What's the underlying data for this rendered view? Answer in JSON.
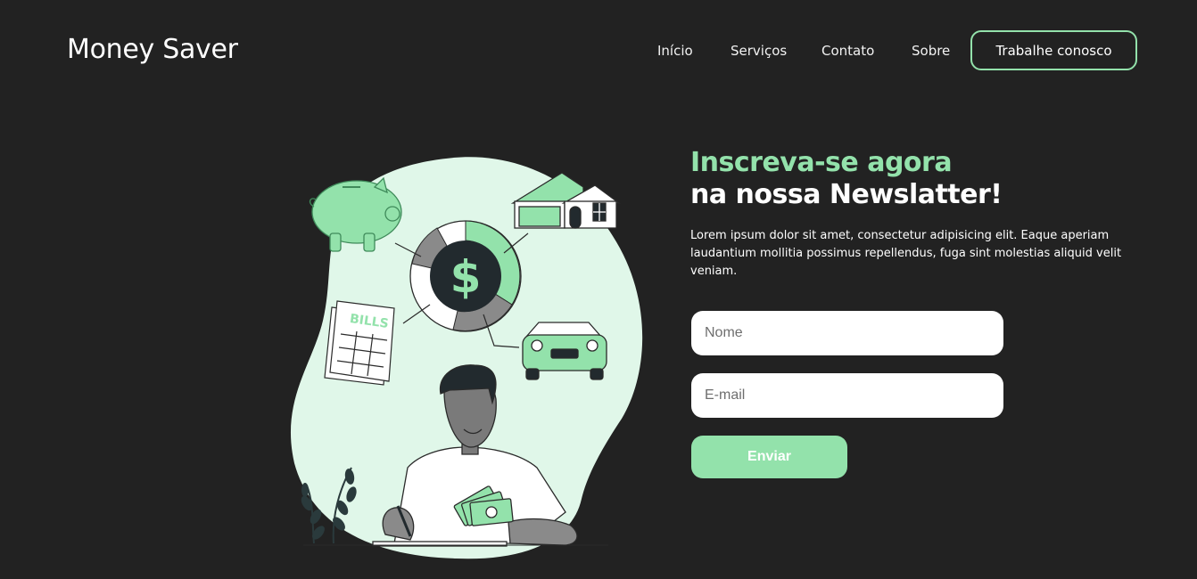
{
  "header": {
    "logo": "Money Saver",
    "nav": [
      "Início",
      "Serviços",
      "Contato",
      "Sobre"
    ],
    "cta": "Trabalhe conosco"
  },
  "hero": {
    "headline_green": "Inscreva-se agora",
    "headline_white": "na nossa Newslatter!",
    "description": "Lorem ipsum dolor sit amet, consectetur adipisicing elit. Eaque aperiam laudantium mollitia possimus repellendus, fuga sint molestias aliquid velit veniam."
  },
  "form": {
    "name_placeholder": "Nome",
    "email_placeholder": "E-mail",
    "submit": "Enviar"
  },
  "illustration": {
    "bills_text": "BILLS",
    "coin_symbol": "$"
  },
  "colors": {
    "background": "#222222",
    "accent": "#93e2ab",
    "blob": "#e0f7e9",
    "dark": "#222a2e"
  }
}
